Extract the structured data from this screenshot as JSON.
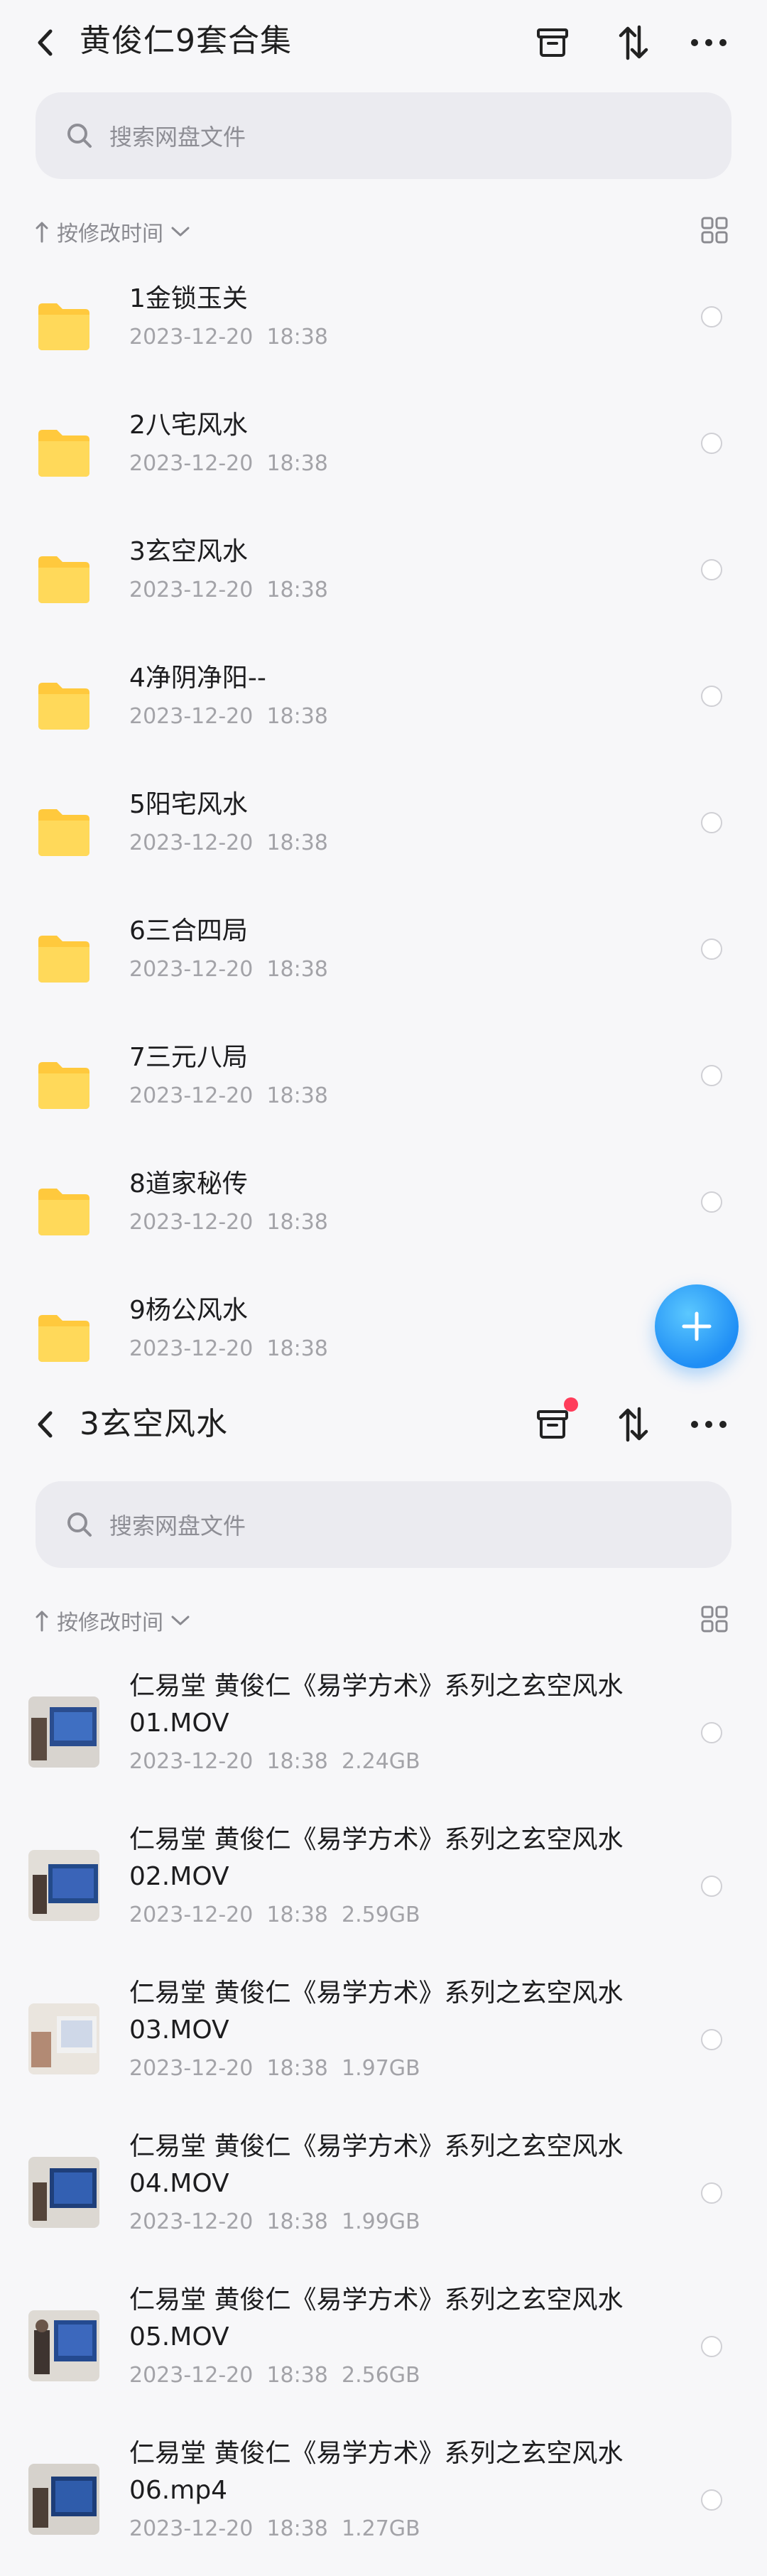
{
  "screen1": {
    "title": "黄俊仁9套合集",
    "search_placeholder": "搜索网盘文件",
    "sort_label": "按修改时间",
    "folders": [
      {
        "name": "1金锁玉关",
        "date": "2023-12-20",
        "time": "18:38"
      },
      {
        "name": "2八宅风水",
        "date": "2023-12-20",
        "time": "18:38"
      },
      {
        "name": "3玄空风水",
        "date": "2023-12-20",
        "time": "18:38"
      },
      {
        "name": "4净阴净阳--",
        "date": "2023-12-20",
        "time": "18:38"
      },
      {
        "name": "5阳宅风水",
        "date": "2023-12-20",
        "time": "18:38"
      },
      {
        "name": "6三合四局",
        "date": "2023-12-20",
        "time": "18:38"
      },
      {
        "name": "7三元八局",
        "date": "2023-12-20",
        "time": "18:38"
      },
      {
        "name": "8道家秘传",
        "date": "2023-12-20",
        "time": "18:38"
      },
      {
        "name": "9杨公风水",
        "date": "2023-12-20",
        "time": "18:38"
      }
    ],
    "fab_icon": "plus-icon"
  },
  "screen2": {
    "title": "3玄空风水",
    "search_placeholder": "搜索网盘文件",
    "sort_label": "按修改时间",
    "files": [
      {
        "name_line1": "仁易堂 黄俊仁《易学方术》系列之玄空风水",
        "name_line2": "01.MOV",
        "date": "2023-12-20",
        "time": "18:38",
        "size": "2.24GB"
      },
      {
        "name_line1": "仁易堂 黄俊仁《易学方术》系列之玄空风水",
        "name_line2": "02.MOV",
        "date": "2023-12-20",
        "time": "18:38",
        "size": "2.59GB"
      },
      {
        "name_line1": "仁易堂 黄俊仁《易学方术》系列之玄空风水",
        "name_line2": "03.MOV",
        "date": "2023-12-20",
        "time": "18:38",
        "size": "1.97GB"
      },
      {
        "name_line1": "仁易堂 黄俊仁《易学方术》系列之玄空风水",
        "name_line2": "04.MOV",
        "date": "2023-12-20",
        "time": "18:38",
        "size": "1.99GB"
      },
      {
        "name_line1": "仁易堂 黄俊仁《易学方术》系列之玄空风水",
        "name_line2": "05.MOV",
        "date": "2023-12-20",
        "time": "18:38",
        "size": "2.56GB"
      },
      {
        "name_line1": "仁易堂 黄俊仁《易学方术》系列之玄空风水",
        "name_line2": "06.mp4",
        "date": "2023-12-20",
        "time": "18:38",
        "size": "1.27GB"
      }
    ]
  },
  "colors": {
    "accent": "#1f8ef5",
    "folder": "#ffc93d",
    "notification_dot": "#ff3d5b"
  }
}
